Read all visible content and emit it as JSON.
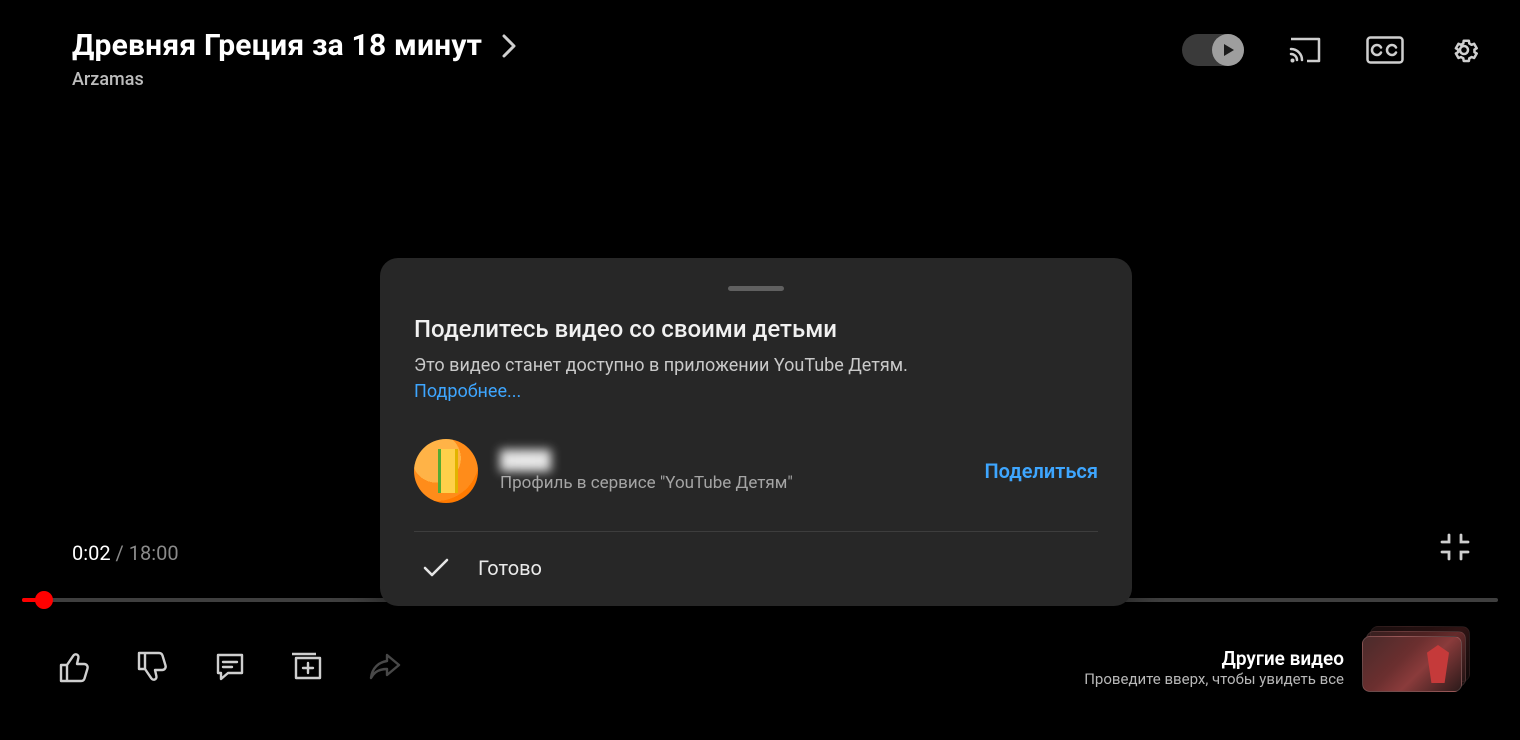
{
  "header": {
    "title": "Древняя Греция за 18 минут",
    "channel": "Arzamas"
  },
  "player": {
    "current_time": "0:02",
    "duration": "18:00",
    "progress_percent": 1.5
  },
  "more": {
    "line1": "Другие видео",
    "line2": "Проведите вверх, чтобы увидеть все"
  },
  "sheet": {
    "title": "Поделитесь видео со своими детьми",
    "description": "Это видео станет доступно в приложении YouTube Детям.",
    "learn_more": "Подробнее...",
    "profile_name": "████",
    "profile_subtitle": "Профиль в сервисе \"YouTube Детям\"",
    "share_action": "Поделиться",
    "done": "Готово"
  },
  "colors": {
    "accent_red": "#ff0000",
    "link_blue": "#3ea6ff",
    "sheet_bg": "#272727"
  }
}
